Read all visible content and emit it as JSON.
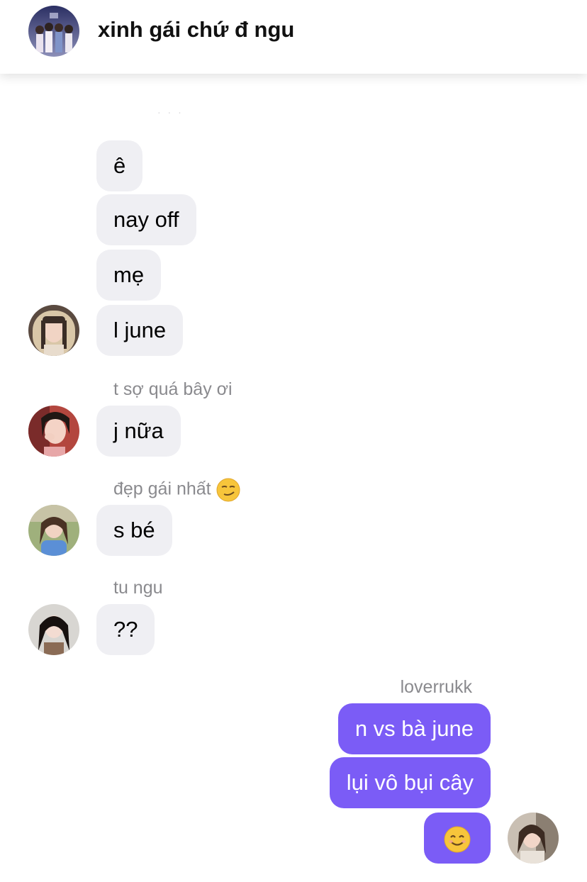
{
  "header": {
    "title": "xinh gái chứ đ ngu",
    "avatar_icon": "group-photo-avatar"
  },
  "faded_preview": "· · ·",
  "messages_incoming": [
    {
      "text": "ê"
    },
    {
      "text": "nay off"
    },
    {
      "text": "mẹ"
    },
    {
      "text": "l june"
    },
    {
      "sender": "t sợ quá bây ơi",
      "text": "j nữa"
    },
    {
      "sender": "đẹp gái nhất",
      "sender_emoji": "smirking-face-emoji",
      "text": "s bé"
    },
    {
      "sender": "tu ngu",
      "text": "??"
    }
  ],
  "messages_outgoing": {
    "sender": "loverrukk",
    "items": [
      {
        "text": "n vs bà june"
      },
      {
        "text": "lụi vô bụi cây"
      },
      {
        "emoji": "smiling-face-emoji"
      }
    ]
  },
  "colors": {
    "incoming_bubble": "#efeff3",
    "outgoing_bubble": "#7b5cf6",
    "sender_name": "#8a8a8e"
  }
}
